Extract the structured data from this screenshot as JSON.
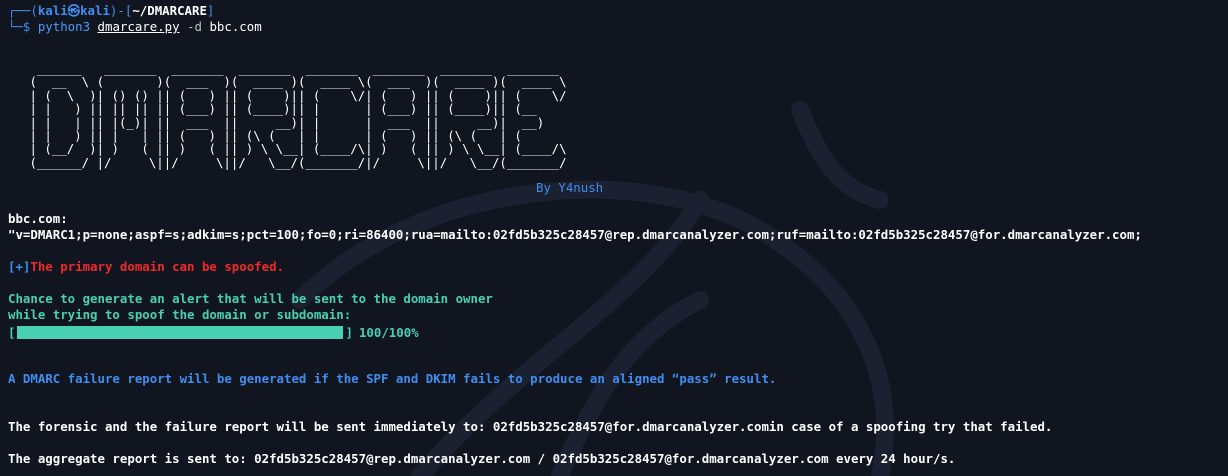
{
  "prompt": {
    "frame_top": "┌──(",
    "user": "kali㉿kali",
    "mid": ")-[",
    "path": "~/DMARCARE",
    "end": "]",
    "frame_bottom": "└─$ ",
    "cmd_word": "python3",
    "cmd_file": "dmarcare.py",
    "cmd_flag": "-d",
    "cmd_arg": "bbc.com"
  },
  "banner": {
    "art": "  ______   _______  _______  _______  _______  _______  _______  _______\n (  __  \\ (       )(  ___  )(  ____ )(  ____ \\(  ___  )(  ____ )(  ____ \\\n | (  \\  )| () () || (   ) || (    )|| (    \\/| (   ) || (    )|| (    \\/\n | |   ) || || || || (___) || (____)|| |      | (___) || (____)|| (__\n | |   | || |(_)| ||  ___  ||     __)| |      |  ___  ||     __)|  __)\n | |   ) || |   | || (   ) || (\\ (   | |      | (   ) || (\\ (   | (\n | (__/  )| )   ( || )   ( || ) \\ \\__| (____/\\| )   ( || ) \\ \\__| (____/\\\n (______/ |/     \\||/     \\||/   \\__/(_______/|/     \\||/   \\__/(_______/",
    "by": "By Y4nush"
  },
  "result": {
    "domain": "bbc.com:",
    "record": "\"v=DMARC1;p=none;aspf=s;adkim=s;pct=100;fo=0;ri=86400;rua=mailto:02fd5b325c28457@rep.dmarcanalyzer.com;ruf=mailto:02fd5b325c28457@for.dmarcanalyzer.com;",
    "spoof_tag": "[+]",
    "spoof_msg": "The primary domain can be spoofed.",
    "chance_line1": "Chance to generate an alert that will be sent to the domain owner",
    "chance_line2": "while trying to spoof the domain or subdomain:",
    "bracket_open": "[",
    "bracket_close": "]",
    "progress_fraction": 1.0,
    "progress_text": "100/100%",
    "failure_report": "A DMARC failure report will be generated if the SPF and DKIM fails to produce an aligned “pass” result.",
    "forensic": "The forensic and the failure report will be sent immediately to: 02fd5b325c28457@for.dmarcanalyzer.comin case of a spoofing try that failed.",
    "aggregate": "The aggregate report is sent to: 02fd5b325c28457@rep.dmarcanalyzer.com / 02fd5b325c28457@for.dmarcanalyzer.com every 24 hour/s."
  },
  "colors": {
    "background": "#11151f",
    "blue": "#3f8ef0",
    "red": "#ee2a2a",
    "teal": "#49d0b3"
  }
}
